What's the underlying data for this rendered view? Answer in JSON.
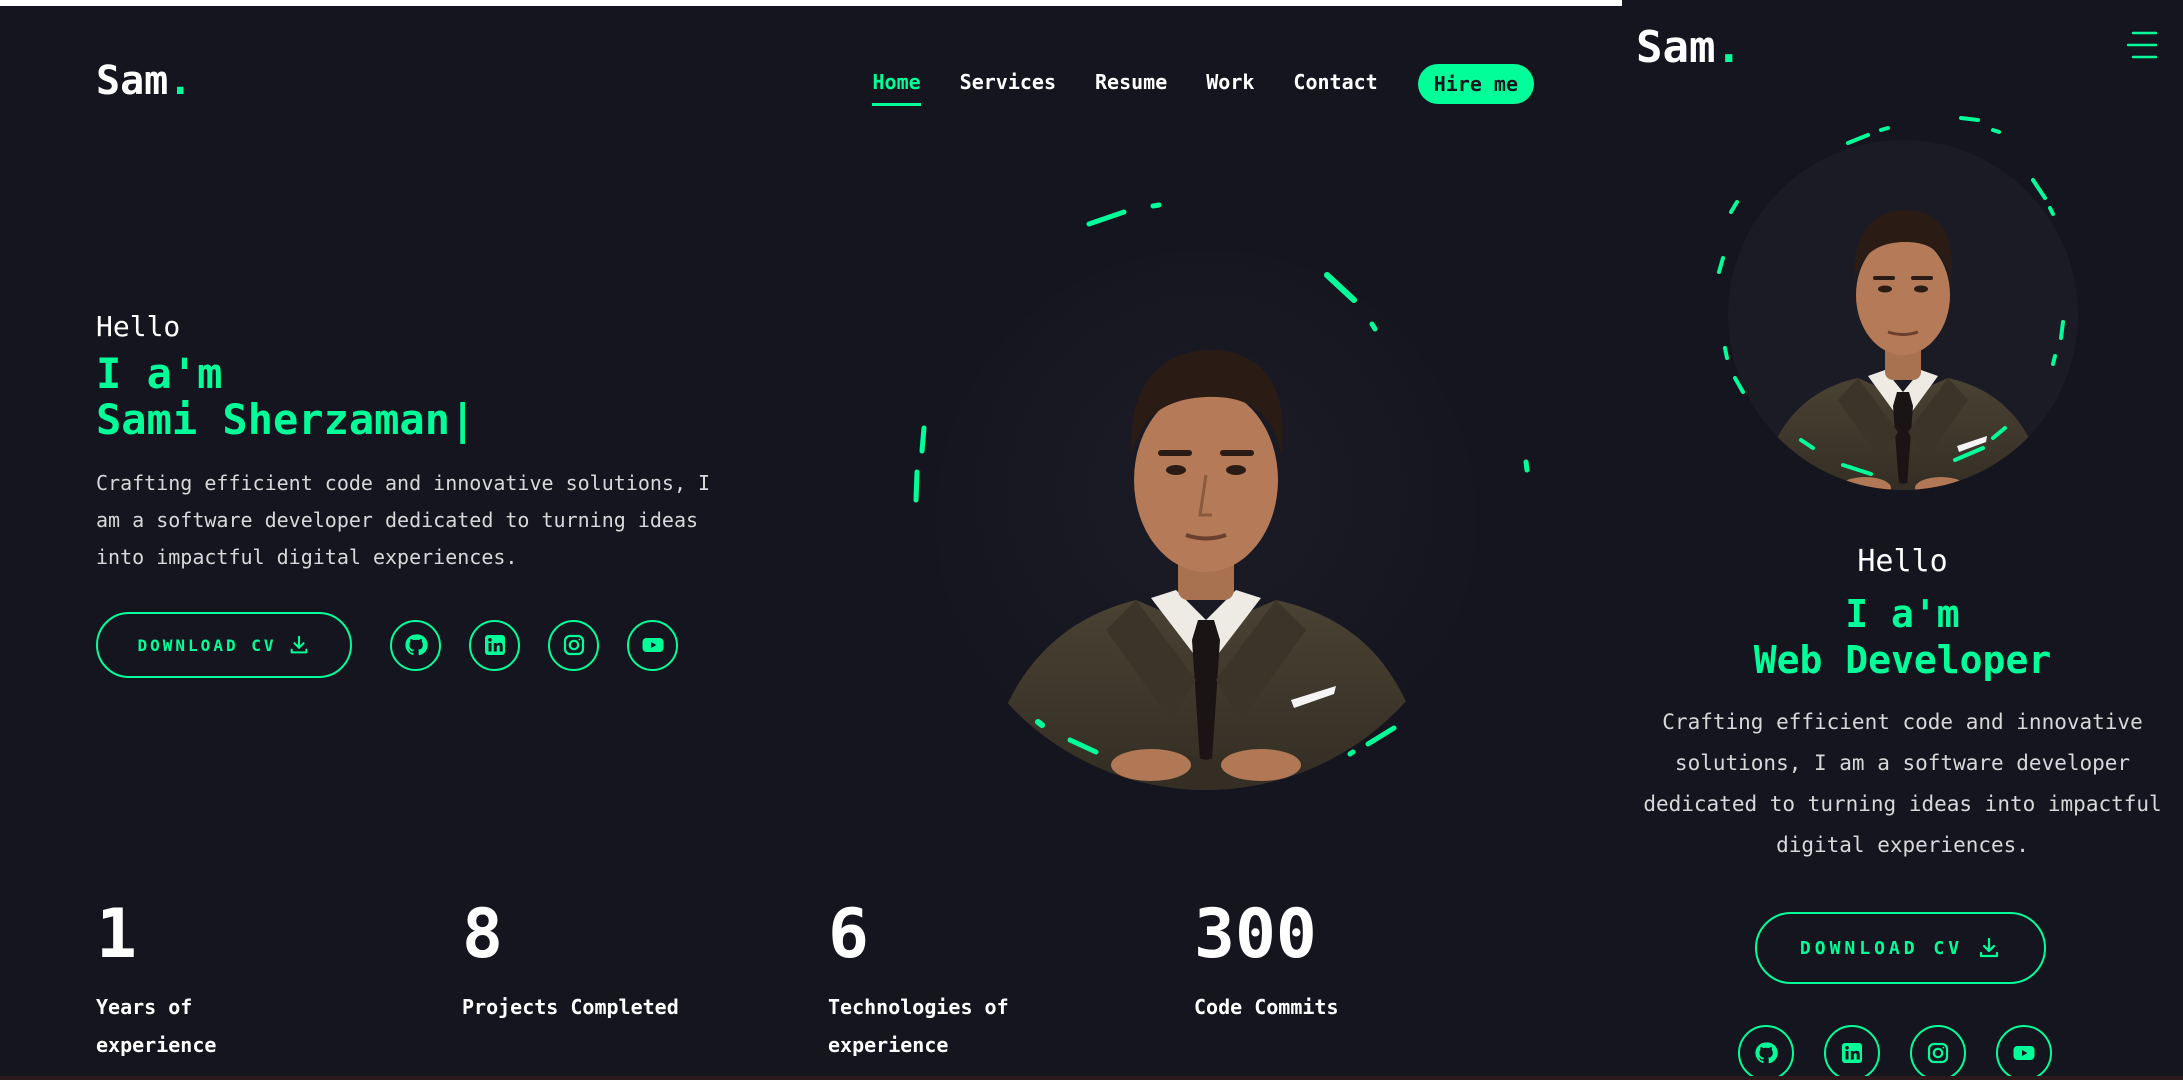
{
  "brand": {
    "name": "Sam",
    "dot": "."
  },
  "nav": {
    "items": [
      "Home",
      "Services",
      "Resume",
      "Work",
      "Contact"
    ],
    "active": "Home",
    "hire_label": "Hire me"
  },
  "hero": {
    "greeting": "Hello",
    "intro": "I a'm",
    "name": "Sami Sherzaman",
    "cursor": "|",
    "description": "Crafting efficient code and innovative solutions, I am a software developer dedicated to turning ideas into impactful digital experiences.",
    "cv_label": "DOWNLOAD CV"
  },
  "socials": [
    "github-icon",
    "linkedin-icon",
    "instagram-icon",
    "youtube-icon"
  ],
  "stats": [
    {
      "value": "1",
      "label": "Years of experience"
    },
    {
      "value": "8",
      "label": "Projects Completed"
    },
    {
      "value": "6",
      "label": "Technologies of experience"
    },
    {
      "value": "300",
      "label": "Code Commits"
    }
  ],
  "mobile": {
    "greeting": "Hello",
    "intro": "I a'm",
    "role": "Web Developer",
    "description": "Crafting efficient code and innovative solutions, I am a software developer dedicated to turning ideas into impactful digital experiences.",
    "cv_label": "DOWNLOAD CV"
  },
  "colors": {
    "accent": "#00ff99",
    "background": "#15151f",
    "text": "#ffffff"
  }
}
